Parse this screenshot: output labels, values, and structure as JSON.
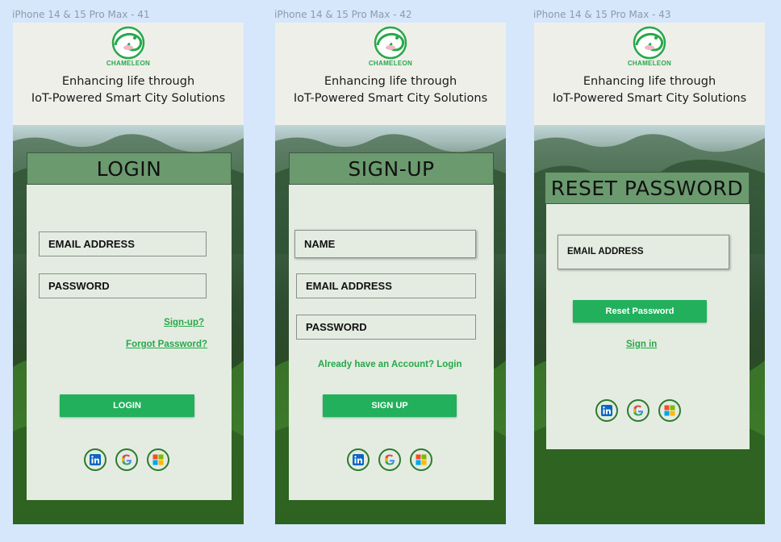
{
  "frames": [
    {
      "frame_label": "iPhone 14 & 15 Pro Max - 41",
      "logo_text": "CHAMELEON",
      "tagline_line1": "Enhancing life through",
      "tagline_line2": "IoT-Powered Smart City Solutions",
      "title": "LOGIN",
      "fields": [
        "EMAIL ADDRESS",
        "PASSWORD"
      ],
      "links": [
        "Sign-up?",
        "Forgot Password?"
      ],
      "button": "LOGIN"
    },
    {
      "frame_label": "iPhone 14 & 15 Pro Max - 42",
      "logo_text": "CHAMELEON",
      "tagline_line1": "Enhancing life through",
      "tagline_line2": "IoT-Powered Smart City Solutions",
      "title": "SIGN-UP",
      "fields": [
        "NAME",
        "EMAIL ADDRESS",
        "PASSWORD"
      ],
      "links": [
        "Already have an Account? Login"
      ],
      "button": "SIGN UP"
    },
    {
      "frame_label": "iPhone 14 & 15 Pro Max - 43",
      "logo_text": "CHAMELEON",
      "tagline_line1": "Enhancing life through",
      "tagline_line2": "IoT-Powered Smart City Solutions",
      "title": "RESET PASSWORD",
      "fields": [
        "EMAIL ADDRESS"
      ],
      "links": [
        "Sign in"
      ],
      "button": "Reset Password"
    }
  ],
  "social_icons": [
    "linkedin-icon",
    "google-icon",
    "microsoft-icon"
  ],
  "colors": {
    "background": "#d6e6fb",
    "header_bg": "#efefea",
    "card_bg": "#e4ece1",
    "card_header": "#6a9a6e",
    "accent_green": "#22b05c",
    "link_green": "#27a84a"
  }
}
